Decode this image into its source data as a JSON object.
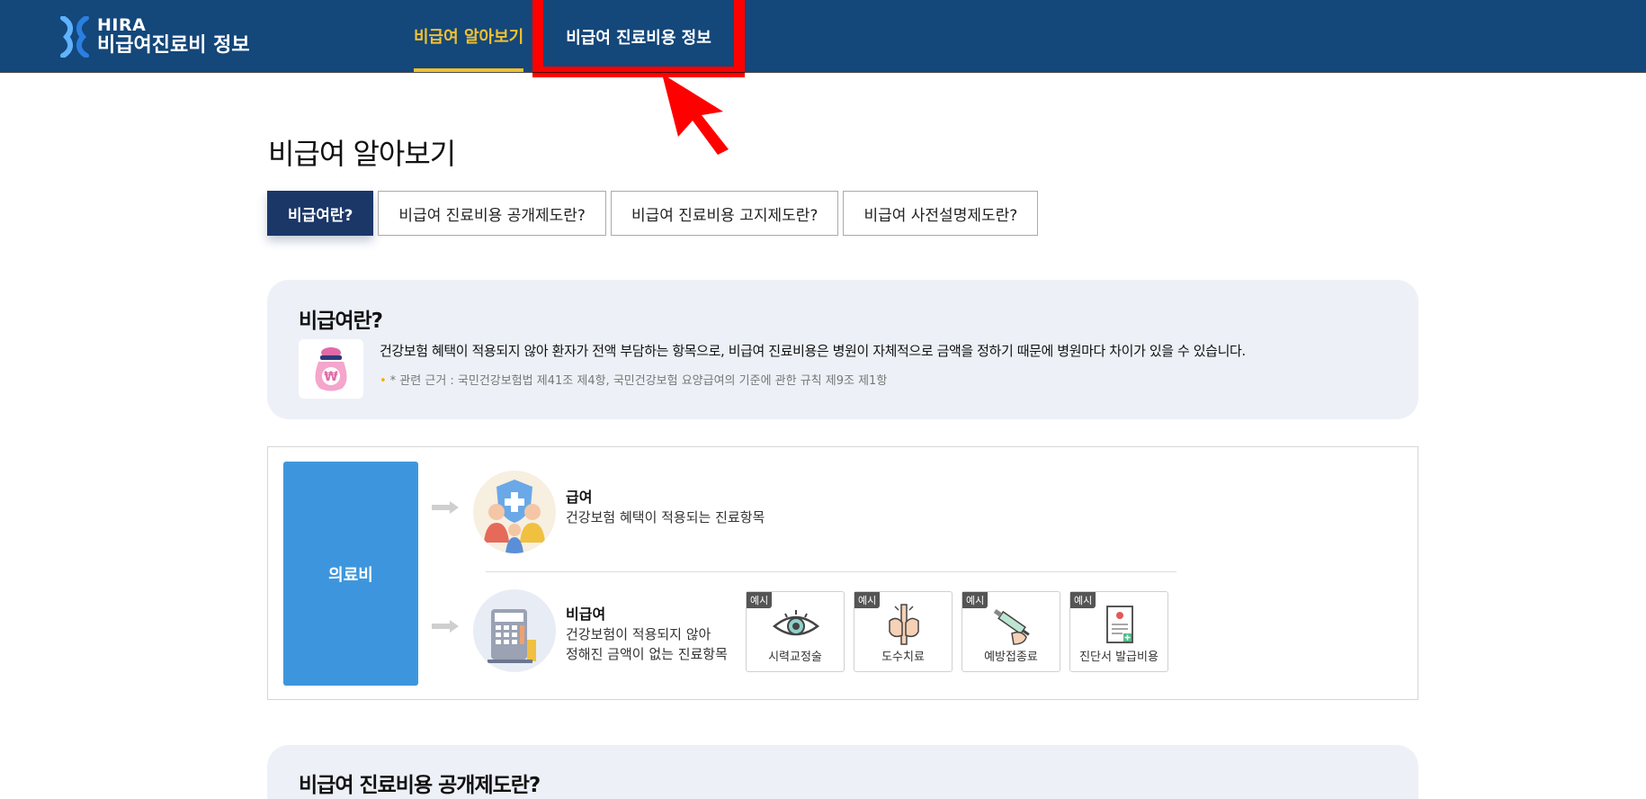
{
  "header": {
    "logo_line1": "HIRA",
    "logo_line2": "비급여진료비 정보",
    "nav": [
      {
        "label": "비급여 알아보기"
      },
      {
        "label": "비급여 진료비용 정보"
      }
    ],
    "bg_color": "#14477a",
    "active_color": "#f2c130",
    "highlight_color": "#ff0000"
  },
  "page_title": "비급여 알아보기",
  "tabs": [
    {
      "label": "비급여란?"
    },
    {
      "label": "비급여 진료비용 공개제도란?"
    },
    {
      "label": "비급여 진료비용 고지제도란?"
    },
    {
      "label": "비급여 사전설명제도란?"
    }
  ],
  "intro_card": {
    "title": "비급여란?",
    "icon": "money-bag-icon",
    "description": "건강보험 혜택이 적용되지 않아 환자가 전액 부담하는 항목으로, 비급여 진료비용은 병원이 자체적으로 금액을 정하기 때문에 병원마다 차이가 있을 수 있습니다.",
    "note": "* 관련 근거 : 국민건강보험법 제41조 제4항, 국민건강보험 요양급여의 기준에 관한 규칙 제9조 제1항"
  },
  "diagram": {
    "root_label": "의료비",
    "benefit": {
      "title": "급여",
      "description": "건강보험 혜택이 적용되는 진료항목"
    },
    "non_benefit": {
      "title": "비급여",
      "description_line1": "건강보험이 적용되지 않아",
      "description_line2": "정해진 금액이 없는 진료항목"
    },
    "examples": [
      {
        "badge": "예시",
        "label": "시력교정술",
        "icon": "eye-icon"
      },
      {
        "badge": "예시",
        "label": "도수치료",
        "icon": "manual-therapy-icon"
      },
      {
        "badge": "예시",
        "label": "예방접종료",
        "icon": "syringe-icon"
      },
      {
        "badge": "예시",
        "label": "진단서 발급비용",
        "icon": "certificate-icon"
      }
    ]
  },
  "second_card": {
    "title": "비급여 진료비용 공개제도란?"
  }
}
